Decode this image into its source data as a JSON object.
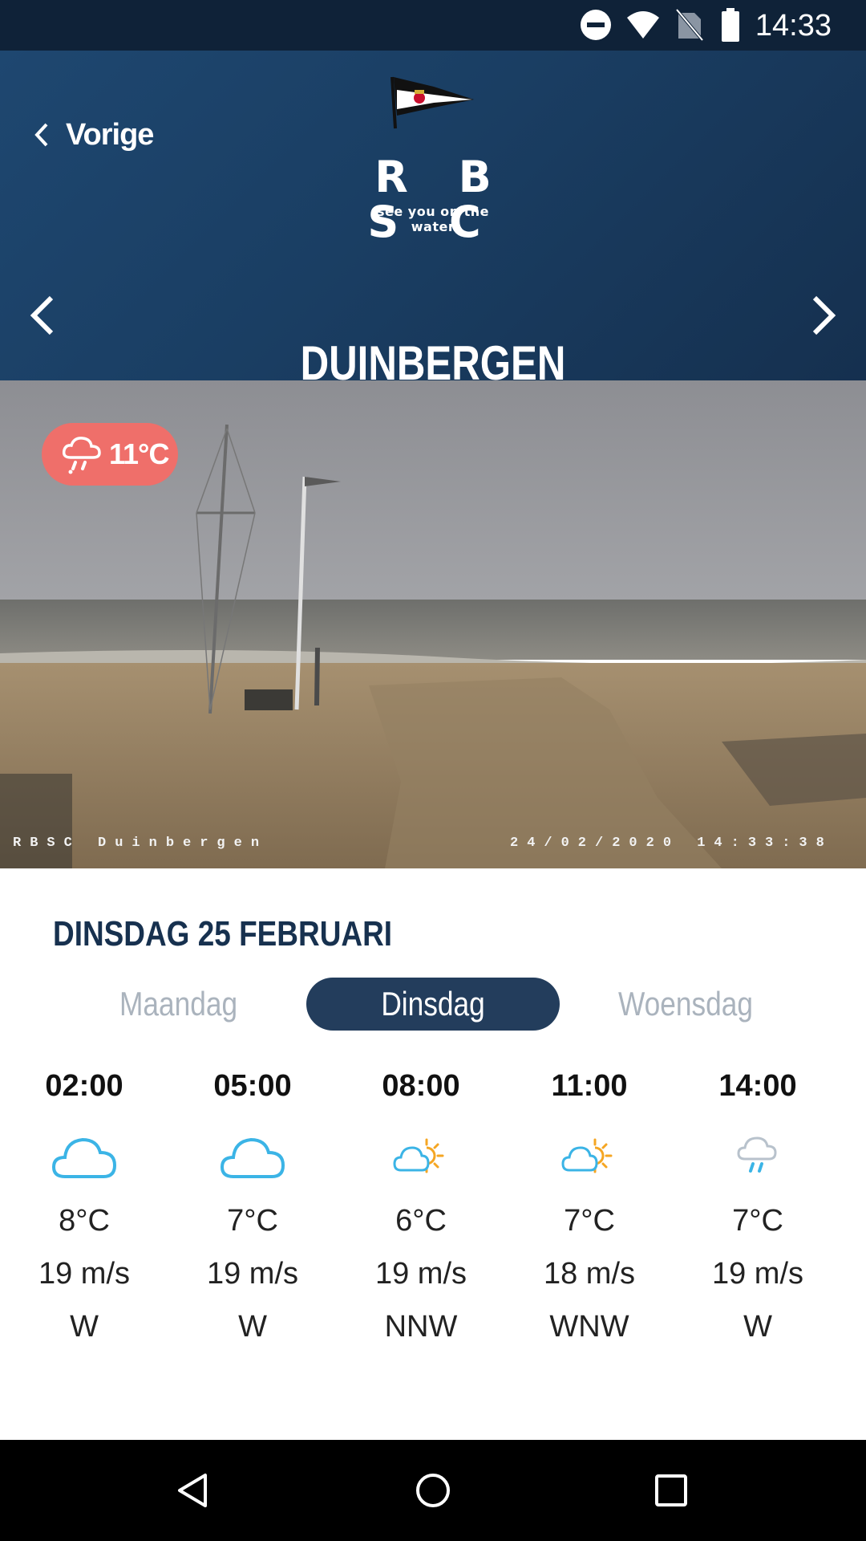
{
  "status_bar": {
    "time": "14:33",
    "icons": [
      "do-not-disturb-icon",
      "wifi-icon",
      "no-sim-icon",
      "battery-icon"
    ]
  },
  "header": {
    "back_label": "Vorige",
    "logo": {
      "name": "R B S C",
      "tagline": "see you on the water"
    },
    "location": "DUINBERGEN",
    "prev_icon": "chevron-left-icon",
    "next_icon": "chevron-right-icon"
  },
  "webcam": {
    "overlay_left": "RBSC Duinbergen",
    "overlay_right": "24/02/2020 14:33:38",
    "weather_badge": {
      "icon": "cloud-rain-icon",
      "temp": "11°C",
      "color": "#ef6f6a"
    }
  },
  "forecast": {
    "date_heading": "DINSDAG 25 FEBRUARI",
    "tabs": [
      {
        "label": "Maandag",
        "active": false
      },
      {
        "label": "Dinsdag",
        "active": true
      },
      {
        "label": "Woensdag",
        "active": false
      }
    ],
    "hours": [
      {
        "time": "02:00",
        "icon": "cloud-icon",
        "temp": "8°C",
        "wind": "19 m/s",
        "dir": "W"
      },
      {
        "time": "05:00",
        "icon": "cloud-icon",
        "temp": "7°C",
        "wind": "19 m/s",
        "dir": "W"
      },
      {
        "time": "08:00",
        "icon": "cloud-sun-icon",
        "temp": "6°C",
        "wind": "19 m/s",
        "dir": "NNW"
      },
      {
        "time": "11:00",
        "icon": "cloud-sun-icon",
        "temp": "7°C",
        "wind": "18 m/s",
        "dir": "WNW"
      },
      {
        "time": "14:00",
        "icon": "cloud-drizzle-icon",
        "temp": "7°C",
        "wind": "19 m/s",
        "dir": "W"
      }
    ]
  },
  "colors": {
    "header": "#1a3e63",
    "accent_tab": "#233d5c",
    "badge": "#ef6f6a",
    "icon_blue": "#3bb4e6",
    "icon_sun": "#f5a623"
  },
  "nav_bar": {
    "icons": [
      "back-icon",
      "home-icon",
      "recents-icon"
    ]
  }
}
